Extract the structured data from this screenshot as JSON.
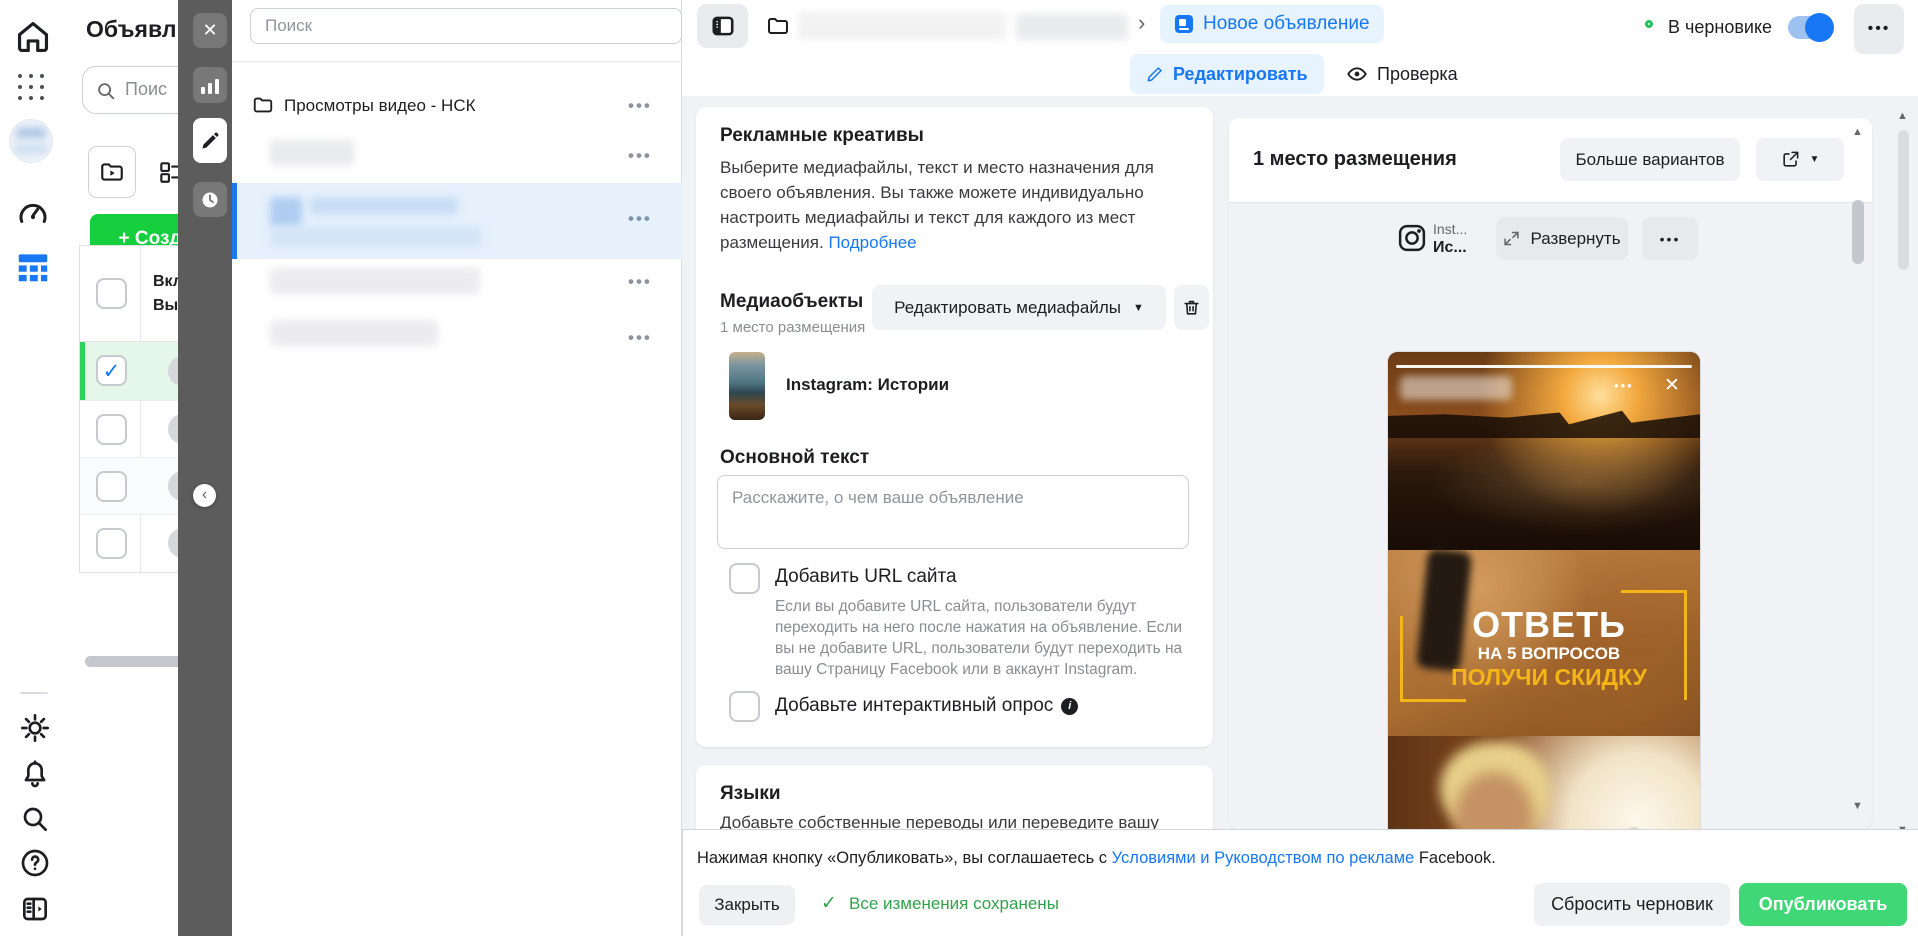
{
  "icons": {
    "dots": "•••",
    "close": "✕",
    "caret": "▼",
    "chevron_right": "›",
    "chevron_left": "‹",
    "check": "✓",
    "info": "i",
    "arrow_up": "▲",
    "arrow_down": "▼"
  },
  "colors": {
    "accent": "#1877f2",
    "accent_bg": "#e7f3ff",
    "publish_green": "#40d776",
    "create_green": "#16cf3f",
    "saved_green": "#31a24c",
    "row_green_bar": "#2ed15c",
    "story_yellow": "#f3b518",
    "toolbar_gray": "#5c5c5c"
  },
  "ads_panel": {
    "title": "Объявл",
    "search_placeholder": "Поис",
    "create_label": "+ Созд",
    "col_header_line1": "Вкл",
    "col_header_line2": "Вы"
  },
  "tree": {
    "search_placeholder": "Поиск",
    "folder_label": "Просмотры видео - НСК"
  },
  "header": {
    "current_crumb": "Новое объявление",
    "tab_edit": "Редактировать",
    "tab_review": "Проверка",
    "status": "В черновике"
  },
  "creative": {
    "title": "Рекламные креативы",
    "description": "Выберите медиафайлы, текст и место назначения для своего объявления. Вы также можете индивидуально настроить медиафайлы и текст для каждого из мест размещения. ",
    "link": "Подробнее",
    "media_title": "Медиаобъекты",
    "media_subtitle": "1 место размещения",
    "edit_media_button": "Редактировать медиафайлы",
    "media_item_label": "Instagram: Истории",
    "body_label": "Основной текст",
    "body_placeholder": "Расскажите, о чем ваше объявление",
    "url_label": "Добавить URL сайта",
    "url_description": "Если вы добавите URL сайта, пользователи будут переходить на него после нажатия на объявление. Если вы не добавите URL, пользователи будут переходить на вашу Страницу Facebook или в аккаунт Instagram.",
    "poll_label": "Добавьте интерактивный опрос"
  },
  "languages": {
    "title": "Языки",
    "description": "Добавьте собственные переводы или переведите вашу"
  },
  "preview": {
    "title": "1 место размещения",
    "more_button": "Больше вариантов",
    "platform_small": "Inst...",
    "platform_bold": "Ис...",
    "expand_button": "Развернуть",
    "story_line1": "ОТВЕТЬ",
    "story_line2": "НА 5 ВОПРОСОВ",
    "story_line3": "ПОЛУЧИ СКИДКУ"
  },
  "footer": {
    "legal_prefix": "Нажимая кнопку «Опубликовать», вы соглашаетесь с ",
    "legal_link": "Условиями и Руководством по рекламе",
    "legal_suffix": " Facebook.",
    "close_button": "Закрыть",
    "saved_status": "Все изменения сохранены",
    "discard_button": "Сбросить черновик",
    "publish_button": "Опубликовать"
  }
}
